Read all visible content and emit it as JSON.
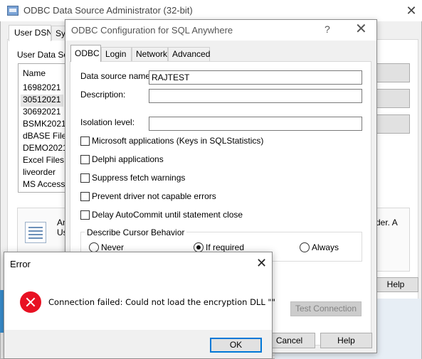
{
  "admin_window": {
    "title": "ODBC Data Source Administrator (32-bit)",
    "tabs": [
      "User DSN",
      "Sy"
    ],
    "list_label": "User Data Sou",
    "list_column": "Name",
    "dsn_items": [
      "16982021",
      "30512021",
      "30692021",
      "BSMK2021",
      "dBASE Files",
      "DEMO2021",
      "Excel Files",
      "liveorder",
      "MS Access"
    ],
    "info_text_line1": "An",
    "info_text_line2": "Us",
    "info_text_tail": "der.  A",
    "help_label": "Help"
  },
  "config_window": {
    "title": "ODBC Configuration for SQL Anywhere",
    "help_glyph": "?",
    "tabs": [
      "ODBC",
      "Login",
      "Network",
      "Advanced"
    ],
    "fields": {
      "data_source_name_label": "Data source name:",
      "data_source_name_value": "RAJTEST",
      "description_label": "Description:",
      "description_value": "",
      "isolation_level_label": "Isolation level:",
      "isolation_level_value": ""
    },
    "checkboxes": [
      "Microsoft applications (Keys in SQLStatistics)",
      "Delphi applications",
      "Suppress fetch warnings",
      "Prevent driver not capable errors",
      "Delay AutoCommit until statement close"
    ],
    "cursor_group_title": "Describe Cursor Behavior",
    "cursor_options": [
      "Never",
      "If required",
      "Always"
    ],
    "cursor_selected": "If required",
    "test_connection_label": "Test Connection",
    "cancel_label": "Cancel",
    "help_label": "Help"
  },
  "error_dialog": {
    "title": "Error",
    "message": "Connection failed: Could not load the encryption DLL \"\"",
    "ok_label": "OK"
  }
}
